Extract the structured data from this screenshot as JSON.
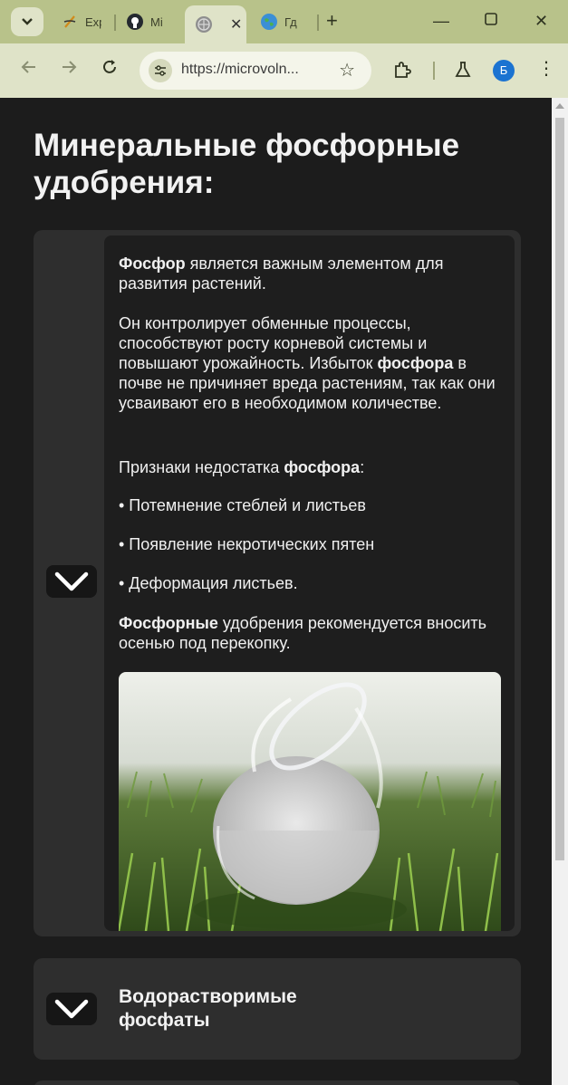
{
  "browser": {
    "tabs": [
      {
        "title": "Exp",
        "favicon": "spark-icon"
      },
      {
        "title": "Mi",
        "favicon": "github-icon"
      },
      {
        "title": "",
        "favicon": "globe-icon",
        "active": true
      },
      {
        "title": "Гд",
        "favicon": "earth-icon"
      }
    ],
    "url": "https://microvoln...",
    "profile_initial": "Б"
  },
  "page": {
    "title": "Минеральные фосфорные удобрения:",
    "phosphorus_card": {
      "p1_bold": "Фосфор",
      "p1_rest": " является важным элементом для развития растений.",
      "p2_start": "Он контролирует обменные процессы, способствуют росту корневой системы и повышают урожайность. Избыток ",
      "p2_bold": "фосфора",
      "p2_end": " в почве не причиняет вреда растениям, так как они усваивают его в необходимом количестве.",
      "p3_start": "Признаки недостатка ",
      "p3_bold": "фосфора",
      "p3_end": ":",
      "signs": [
        "• Потемнение стеблей и листьев",
        "• Появление некротических пятен",
        "• Деформация листьев."
      ],
      "p4_bold": "Фосфорные",
      "p4_rest": " удобрения рекомендуется вносить осенью под перекопку."
    },
    "second_card_title": "Водорастворимые фосфаты"
  },
  "colors": {
    "tabbar": "#b8c28a",
    "toolbar": "#dfe3c8",
    "page_bg": "#1c1c1c",
    "card_bg": "#2e2e2e",
    "content_bg": "#1e1e1e",
    "avatar": "#1b73d1"
  }
}
